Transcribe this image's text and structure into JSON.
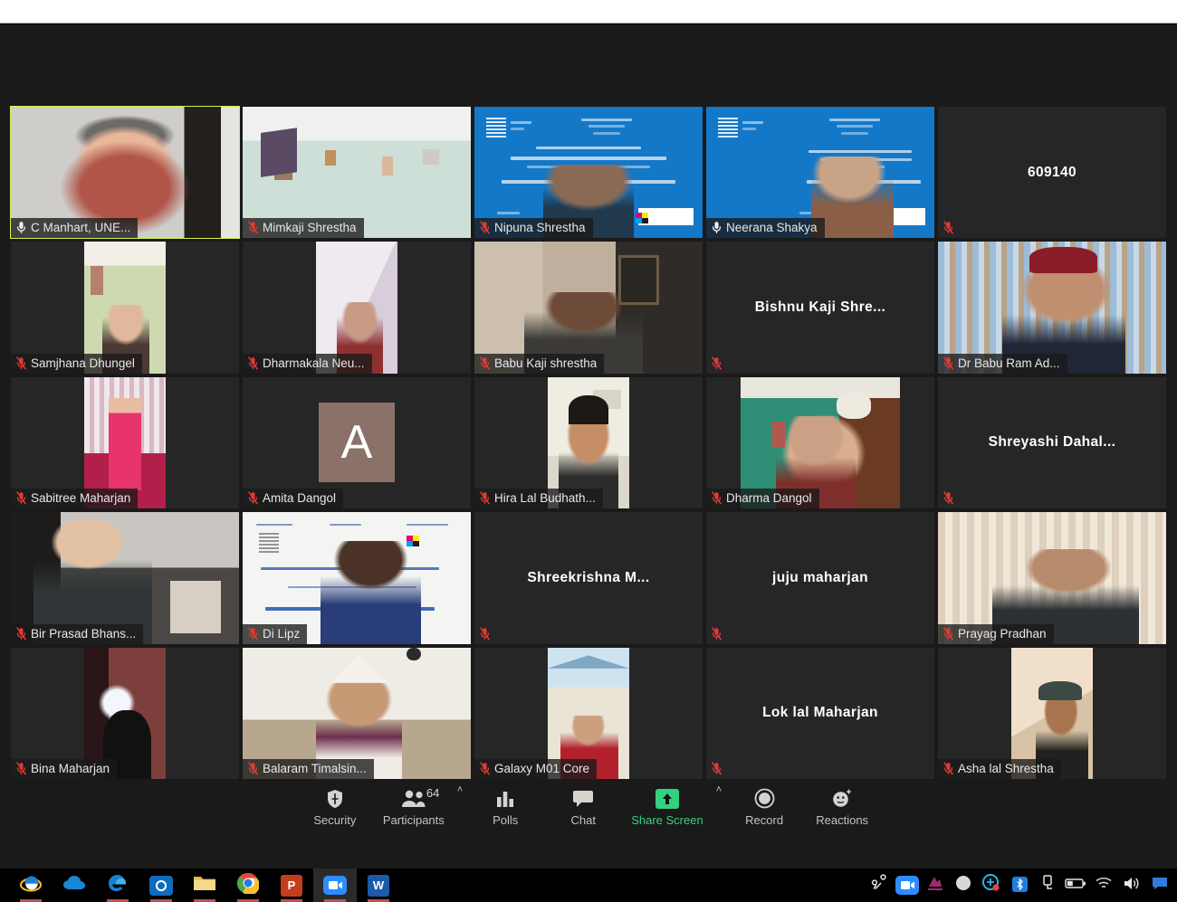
{
  "app": {
    "name": "Zoom Meeting",
    "view": "gallery"
  },
  "gallery": {
    "rows": 5,
    "cols": 5,
    "tiles": [
      {
        "name": "C Manhart, UNE...",
        "speaking": true,
        "muted": false,
        "video": true,
        "label_style": "plate",
        "kind": "person-man-red"
      },
      {
        "name": "Mimkaji Shrestha",
        "speaking": false,
        "muted": true,
        "video": true,
        "label_style": "plate",
        "kind": "room-teal"
      },
      {
        "name": "Nipuna Shrestha",
        "speaking": false,
        "muted": true,
        "video": true,
        "label_style": "plate",
        "kind": "slide-blue-1"
      },
      {
        "name": "Neerana Shakya",
        "speaking": false,
        "muted": false,
        "video": true,
        "label_style": "plate",
        "kind": "slide-blue-2"
      },
      {
        "name": "609140",
        "speaking": false,
        "muted": true,
        "video": false,
        "label_style": "center",
        "kind": "none"
      },
      {
        "name": "Samjhana Dhungel",
        "speaking": false,
        "muted": true,
        "video": true,
        "label_style": "plate",
        "kind": "portrait-green"
      },
      {
        "name": "Dharmakala Neu...",
        "speaking": false,
        "muted": true,
        "video": true,
        "label_style": "plate",
        "kind": "portrait-lilac"
      },
      {
        "name": "Babu Kaji shrestha",
        "speaking": false,
        "muted": true,
        "video": true,
        "label_style": "plate",
        "kind": "room-curtain-grey"
      },
      {
        "name": "Bishnu  Kaji  Shre...",
        "speaking": false,
        "muted": true,
        "video": false,
        "label_style": "center",
        "kind": "none"
      },
      {
        "name": "Dr Babu Ram Ad...",
        "speaking": false,
        "muted": true,
        "video": true,
        "label_style": "plate",
        "kind": "curtain-blue-man"
      },
      {
        "name": "Sabitree Maharjan",
        "speaking": false,
        "muted": true,
        "video": true,
        "label_style": "plate",
        "kind": "portrait-pink-sari"
      },
      {
        "name": "Amita Dangol",
        "speaking": false,
        "muted": true,
        "video": false,
        "label_style": "plate",
        "kind": "avatar-letter",
        "avatar_letter": "A"
      },
      {
        "name": "Hira Lal Budhath...",
        "speaking": false,
        "muted": true,
        "video": true,
        "label_style": "plate",
        "kind": "portrait-boy"
      },
      {
        "name": "Dharma Dangol",
        "speaking": false,
        "muted": true,
        "video": true,
        "label_style": "plate",
        "kind": "green-wall-man"
      },
      {
        "name": "Shreyashi  Dahal...",
        "speaking": false,
        "muted": true,
        "video": false,
        "label_style": "center",
        "kind": "none"
      },
      {
        "name": "Bir Prasad Bhans...",
        "speaking": false,
        "muted": true,
        "video": true,
        "label_style": "plate",
        "kind": "office-man"
      },
      {
        "name": "Di Lipz",
        "speaking": false,
        "muted": true,
        "video": true,
        "label_style": "plate",
        "kind": "slide-white-man"
      },
      {
        "name": "Shreekrishna  M...",
        "speaking": false,
        "muted": true,
        "video": false,
        "label_style": "center",
        "kind": "none"
      },
      {
        "name": "juju maharjan",
        "speaking": false,
        "muted": true,
        "video": false,
        "label_style": "center",
        "kind": "none"
      },
      {
        "name": "Prayag Pradhan",
        "speaking": false,
        "muted": true,
        "video": true,
        "label_style": "plate",
        "kind": "curtain-cream-man"
      },
      {
        "name": "Bina Maharjan",
        "speaking": false,
        "muted": true,
        "video": true,
        "label_style": "plate",
        "kind": "portrait-dark-room"
      },
      {
        "name": "Balaram Timalsin...",
        "speaking": false,
        "muted": true,
        "video": true,
        "label_style": "plate",
        "kind": "white-room-topi"
      },
      {
        "name": "Galaxy M01 Core",
        "speaking": false,
        "muted": true,
        "video": true,
        "label_style": "plate",
        "kind": "portrait-red-lady"
      },
      {
        "name": "Lok lal Maharjan",
        "speaking": false,
        "muted": true,
        "video": false,
        "label_style": "center",
        "kind": "none"
      },
      {
        "name": "Asha lal Shrestha",
        "speaking": false,
        "muted": true,
        "video": true,
        "label_style": "plate",
        "kind": "portrait-cap-man"
      }
    ]
  },
  "toolbar": {
    "items": [
      {
        "id": "security",
        "label": "Security",
        "icon": "shield-icon",
        "has_caret": false,
        "badge": ""
      },
      {
        "id": "participants",
        "label": "Participants",
        "icon": "people-icon",
        "has_caret": true,
        "badge": "64"
      },
      {
        "id": "polls",
        "label": "Polls",
        "icon": "bar-chart-icon",
        "has_caret": false,
        "badge": ""
      },
      {
        "id": "chat",
        "label": "Chat",
        "icon": "speech-bubble-icon",
        "has_caret": false,
        "badge": ""
      },
      {
        "id": "share-screen",
        "label": "Share Screen",
        "icon": "share-arrow-icon",
        "has_caret": true,
        "badge": ""
      },
      {
        "id": "record",
        "label": "Record",
        "icon": "record-circle-icon",
        "has_caret": false,
        "badge": ""
      },
      {
        "id": "reactions",
        "label": "Reactions",
        "icon": "smiley-icon",
        "has_caret": false,
        "badge": ""
      }
    ],
    "share_accent_color": "#35d07f"
  },
  "taskbar": {
    "apps": [
      {
        "id": "internet-explorer",
        "icon": "ie-icon",
        "active": false
      },
      {
        "id": "onedrive",
        "icon": "cloud-icon",
        "active": false
      },
      {
        "id": "edge",
        "icon": "edge-icon",
        "active": false
      },
      {
        "id": "outlook",
        "icon": "outlook-icon",
        "active": false
      },
      {
        "id": "file-explorer",
        "icon": "folder-icon",
        "active": false
      },
      {
        "id": "chrome",
        "icon": "chrome-icon",
        "active": false
      },
      {
        "id": "powerpoint",
        "icon": "powerpoint-icon",
        "active": false
      },
      {
        "id": "zoom",
        "icon": "zoom-icon",
        "active": true
      },
      {
        "id": "word",
        "icon": "word-icon",
        "active": false
      }
    ],
    "tray": [
      {
        "id": "share-nearby",
        "icon": "share-nodes-icon"
      },
      {
        "id": "zoom-tray",
        "icon": "zoom-icon"
      },
      {
        "id": "nitro",
        "icon": "nitro-icon"
      },
      {
        "id": "cortana",
        "icon": "circle-icon"
      },
      {
        "id": "teamviewer",
        "icon": "teamviewer-icon"
      },
      {
        "id": "bluetooth",
        "icon": "bluetooth-icon"
      },
      {
        "id": "usb-eject",
        "icon": "usb-icon"
      },
      {
        "id": "battery",
        "icon": "battery-icon"
      },
      {
        "id": "wifi",
        "icon": "wifi-icon"
      },
      {
        "id": "volume",
        "icon": "speaker-icon"
      },
      {
        "id": "action-center",
        "icon": "notification-icon"
      }
    ]
  }
}
